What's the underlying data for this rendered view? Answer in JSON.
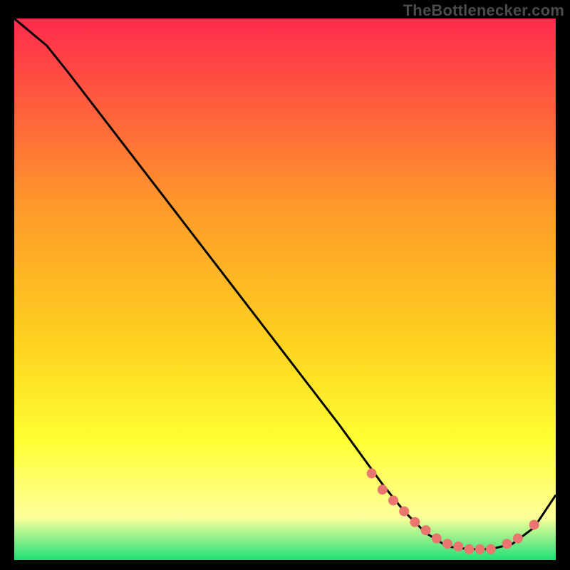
{
  "watermark": "TheBottlenecker.com",
  "colors": {
    "bg": "#000000",
    "curve": "#000000",
    "marker": "#e9766f",
    "grad_top": "#ff2a4d",
    "grad_mid1": "#ff7a2e",
    "grad_mid2": "#ffd21f",
    "grad_mid3": "#ffff33",
    "grad_low": "#ffff9a",
    "grad_bottom": "#1fe077"
  },
  "chart_data": {
    "type": "line",
    "title": "",
    "xlabel": "",
    "ylabel": "",
    "xlim": [
      0,
      100
    ],
    "ylim": [
      0,
      100
    ],
    "series": [
      {
        "name": "curve",
        "x": [
          0,
          6,
          10,
          20,
          30,
          40,
          50,
          60,
          68,
          72,
          76,
          80,
          84,
          88,
          92,
          96,
          100
        ],
        "y": [
          100,
          95,
          90,
          77,
          64,
          51,
          38,
          25,
          14,
          9,
          5,
          2.5,
          2,
          2,
          3,
          6,
          12
        ]
      }
    ],
    "markers": {
      "name": "highlight",
      "x": [
        66,
        68,
        70,
        72,
        74,
        76,
        78,
        80,
        82,
        84,
        86,
        88,
        91,
        93,
        96
      ],
      "y": [
        16,
        13,
        11,
        9,
        7,
        5.5,
        4,
        3,
        2.5,
        2,
        2,
        2,
        3,
        4,
        6.5
      ]
    }
  }
}
